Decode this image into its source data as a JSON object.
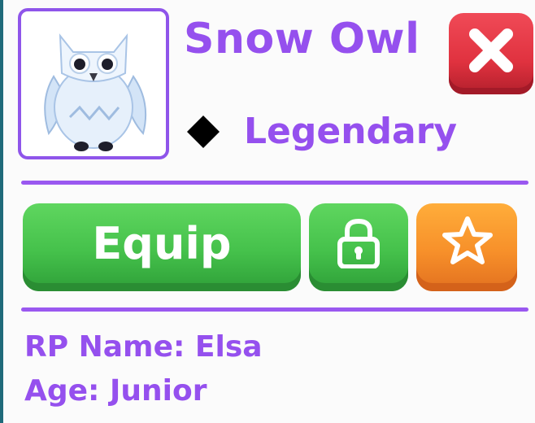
{
  "pet": {
    "name": "Snow Owl",
    "rarity": "Legendary",
    "portrait_icon": "snow-owl-icon"
  },
  "actions": {
    "equip_label": "Equip",
    "lock_icon": "lock-icon",
    "favorite_icon": "star-icon",
    "close_icon": "close-icon"
  },
  "info": {
    "rp_name": "RP Name: Elsa",
    "age": "Age: Junior"
  },
  "colors": {
    "accent_purple": "#9550ee",
    "equip_green": "#45c14b",
    "favorite_orange": "#f7902a",
    "close_red": "#e0323f"
  }
}
